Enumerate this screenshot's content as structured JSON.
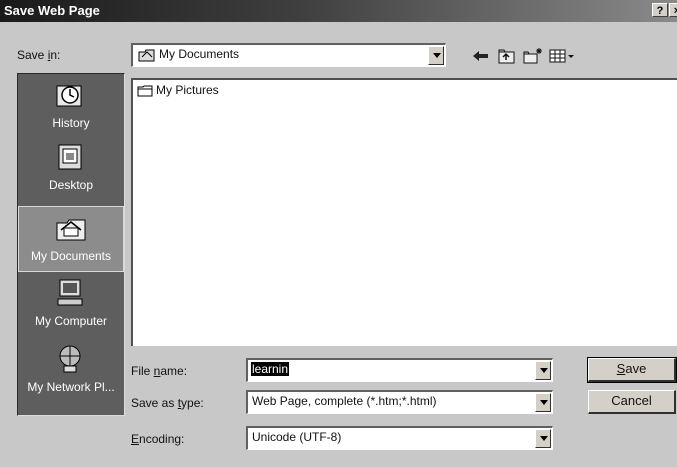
{
  "window": {
    "title": "Save Web Page",
    "help": "?",
    "close": "×"
  },
  "save_in": {
    "label_pre": "Save ",
    "label_u": "i",
    "label_post": "n:",
    "value": "My Documents"
  },
  "places": [
    {
      "label": "History"
    },
    {
      "label": "Desktop"
    },
    {
      "label": "My Documents"
    },
    {
      "label": "My Computer"
    },
    {
      "label": "My Network Pl..."
    }
  ],
  "files": [
    {
      "name": "My Pictures"
    }
  ],
  "file_name": {
    "label_pre": "File ",
    "label_u": "n",
    "label_post": "ame:",
    "value": "learnin"
  },
  "save_as_type": {
    "label_pre": "Save as ",
    "label_u": "t",
    "label_post": "ype:",
    "value": "Web Page, complete (*.htm;*.html)"
  },
  "encoding": {
    "label_u": "E",
    "label_post": "ncoding:",
    "value": "Unicode (UTF-8)"
  },
  "buttons": {
    "save_u": "S",
    "save_post": "ave",
    "cancel": "Cancel"
  }
}
